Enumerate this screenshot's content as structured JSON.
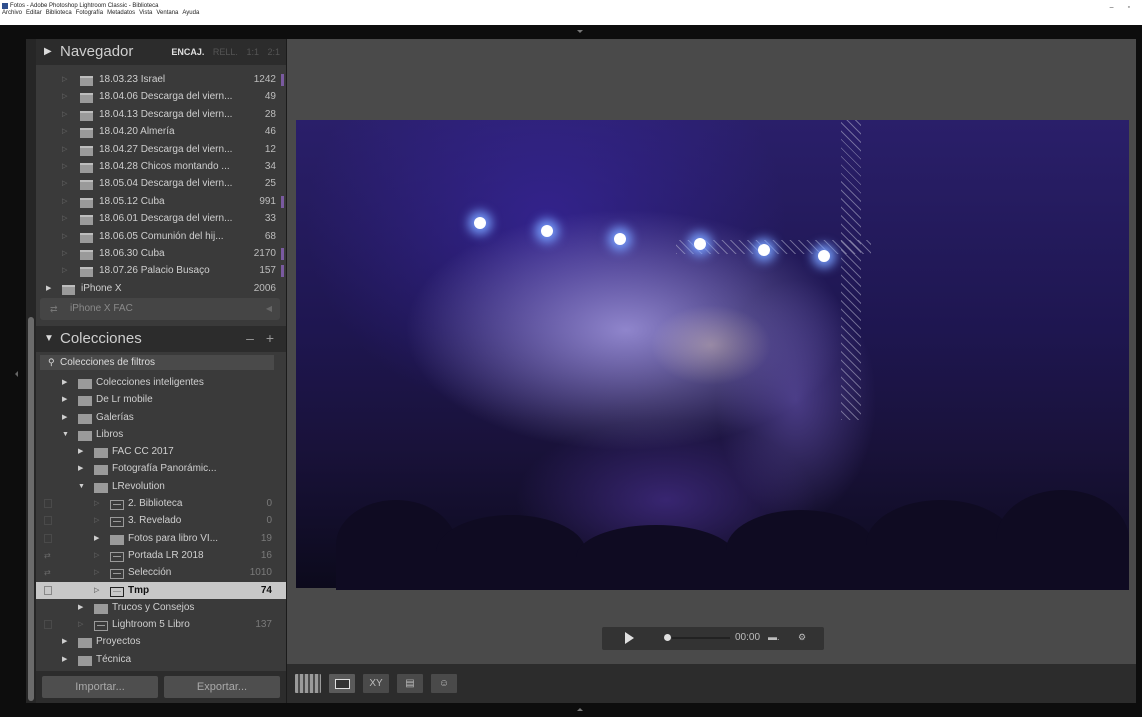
{
  "window": {
    "title": "Fotos - Adobe Photoshop Lightroom Classic - Biblioteca",
    "menu": [
      "Archivo",
      "Editar",
      "Biblioteca",
      "Fotografía",
      "Metadatos",
      "Vista",
      "Ventana",
      "Ayuda"
    ],
    "controls": "– ▫"
  },
  "navigator": {
    "title": "Navegador",
    "options": [
      "ENCAJ.",
      "RELL.",
      "1:1",
      "2:1"
    ]
  },
  "folders": [
    {
      "name": "18.03.23 Israel",
      "count": "1242",
      "marked": true
    },
    {
      "name": "18.04.06 Descarga del viern...",
      "count": "49",
      "marked": false
    },
    {
      "name": "18.04.13 Descarga del viern...",
      "count": "28",
      "marked": false
    },
    {
      "name": "18.04.20 Almería",
      "count": "46",
      "marked": false
    },
    {
      "name": "18.04.27 Descarga del viern...",
      "count": "12",
      "marked": false
    },
    {
      "name": "18.04.28 Chicos montando ...",
      "count": "34",
      "marked": false
    },
    {
      "name": "18.05.04 Descarga del viern...",
      "count": "25",
      "marked": false
    },
    {
      "name": "18.05.12 Cuba",
      "count": "991",
      "marked": true
    },
    {
      "name": "18.06.01 Descarga del viern...",
      "count": "33",
      "marked": false
    },
    {
      "name": "18.06.05 Comunión del hij...",
      "count": "68",
      "marked": false
    },
    {
      "name": "18.06.30 Cuba",
      "count": "2170",
      "marked": true
    },
    {
      "name": "18.07.26 Palacio Busaço",
      "count": "157",
      "marked": true
    }
  ],
  "device": {
    "name": "iPhone X",
    "count": "2006"
  },
  "volume": {
    "name": "iPhone X FAC"
  },
  "collections": {
    "title": "Colecciones",
    "actions": "– +",
    "filter_label": "Colecciones de filtros",
    "items": [
      {
        "name": "Colecciones inteligentes",
        "count": "",
        "level": 1,
        "set": true,
        "expanded": false,
        "selected": false,
        "checkbox": false
      },
      {
        "name": "De Lr mobile",
        "count": "",
        "level": 1,
        "set": true,
        "expanded": false,
        "selected": false,
        "checkbox": false
      },
      {
        "name": "Galerías",
        "count": "",
        "level": 1,
        "set": true,
        "expanded": false,
        "selected": false,
        "checkbox": false
      },
      {
        "name": "Libros",
        "count": "",
        "level": 1,
        "set": true,
        "expanded": true,
        "selected": false,
        "checkbox": false
      },
      {
        "name": "FAC CC 2017",
        "count": "",
        "level": 2,
        "set": true,
        "expanded": false,
        "selected": false,
        "checkbox": false
      },
      {
        "name": "Fotografía Panorámic...",
        "count": "",
        "level": 2,
        "set": true,
        "expanded": false,
        "selected": false,
        "checkbox": false
      },
      {
        "name": "LRevolution",
        "count": "",
        "level": 2,
        "set": true,
        "expanded": true,
        "selected": false,
        "checkbox": false
      },
      {
        "name": "2. Biblioteca",
        "count": "0",
        "level": 3,
        "set": false,
        "expanded": false,
        "selected": false,
        "checkbox": true
      },
      {
        "name": "3. Revelado",
        "count": "0",
        "level": 3,
        "set": false,
        "expanded": false,
        "selected": false,
        "checkbox": true
      },
      {
        "name": "Fotos para libro VI...",
        "count": "19",
        "level": 3,
        "set": true,
        "expanded": false,
        "selected": false,
        "checkbox": true
      },
      {
        "name": "Portada LR 2018",
        "count": "16",
        "level": 3,
        "set": false,
        "expanded": false,
        "selected": false,
        "checkbox": false,
        "sync": true
      },
      {
        "name": "Selección",
        "count": "1010",
        "level": 3,
        "set": false,
        "expanded": false,
        "selected": false,
        "checkbox": false,
        "sync": true
      },
      {
        "name": "Tmp",
        "count": "74",
        "level": 3,
        "set": false,
        "expanded": false,
        "selected": true,
        "checkbox": true
      },
      {
        "name": "Trucos y Consejos",
        "count": "",
        "level": 2,
        "set": true,
        "expanded": false,
        "selected": false,
        "checkbox": false
      },
      {
        "name": "Lightroom 5 Libro",
        "count": "137",
        "level": 2,
        "set": false,
        "expanded": false,
        "selected": false,
        "checkbox": true
      },
      {
        "name": "Proyectos",
        "count": "",
        "level": 1,
        "set": true,
        "expanded": false,
        "selected": false,
        "checkbox": false
      },
      {
        "name": "Técnica",
        "count": "",
        "level": 1,
        "set": true,
        "expanded": false,
        "selected": false,
        "checkbox": false
      }
    ]
  },
  "buttons": {
    "import": "Importar...",
    "export": "Exportar..."
  },
  "video": {
    "time": "00:00",
    "frame_icon": "frame-capture-icon",
    "settings_icon": "gear-icon"
  },
  "toolbar": {
    "views": [
      "grid-view-icon",
      "loupe-view-icon",
      "compare-view-icon",
      "survey-view-icon",
      "people-view-icon"
    ],
    "compare_label": "XY"
  },
  "colors": {
    "accent_mark": "#7a5aa0",
    "panel_bg": "#3a3a3a",
    "header_bg": "#2c2c2c",
    "selected_row": "#c8c8c8"
  }
}
